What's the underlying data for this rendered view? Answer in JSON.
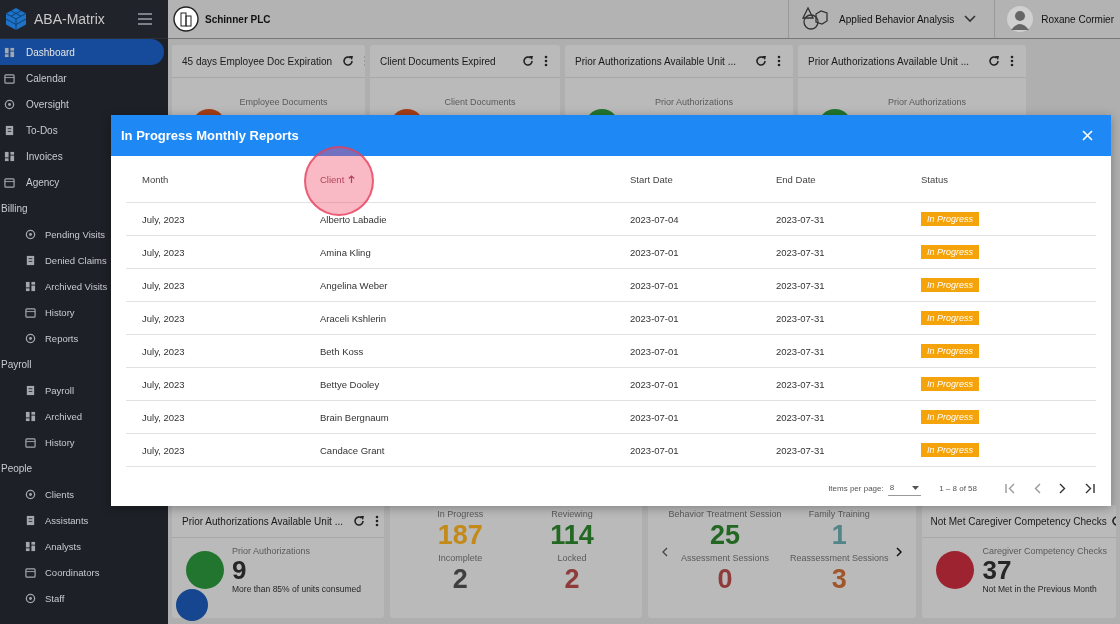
{
  "app": {
    "name": "ABA-Matrix"
  },
  "topbar": {
    "company": "Schinner PLC",
    "program": "Applied Behavior Analysis",
    "user": "Roxane Cormier"
  },
  "sidebar": {
    "items": [
      {
        "kind": "link",
        "label": "Dashboard",
        "selected": true
      },
      {
        "kind": "link",
        "label": "Calendar",
        "selected": false
      },
      {
        "kind": "link",
        "label": "Oversight",
        "selected": false
      },
      {
        "kind": "link",
        "label": "To-Dos",
        "selected": false
      },
      {
        "kind": "link",
        "label": "Invoices",
        "selected": false
      },
      {
        "kind": "link",
        "label": "Agency",
        "selected": false
      },
      {
        "kind": "section",
        "label": "Billing",
        "children": [
          {
            "kind": "link",
            "label": "Pending Visits",
            "selected": false
          },
          {
            "kind": "link",
            "label": "Denied Claims",
            "selected": false
          },
          {
            "kind": "link",
            "label": "Archived Visits",
            "selected": false
          },
          {
            "kind": "link",
            "label": "History",
            "selected": false
          },
          {
            "kind": "link",
            "label": "Reports",
            "selected": false
          }
        ]
      },
      {
        "kind": "section",
        "label": "Payroll",
        "children": [
          {
            "kind": "link",
            "label": "Payroll",
            "selected": false
          },
          {
            "kind": "link",
            "label": "Archived",
            "selected": false
          },
          {
            "kind": "link",
            "label": "History",
            "selected": false
          }
        ]
      },
      {
        "kind": "section",
        "label": "People",
        "children": [
          {
            "kind": "link",
            "label": "Clients",
            "selected": false
          },
          {
            "kind": "link",
            "label": "Assistants",
            "selected": false
          },
          {
            "kind": "link",
            "label": "Analysts",
            "selected": false
          },
          {
            "kind": "link",
            "label": "Coordinators",
            "selected": false
          },
          {
            "kind": "link",
            "label": "Staff",
            "selected": false
          }
        ]
      }
    ]
  },
  "top_cards": [
    {
      "title": "45 days Employee Doc Expiration",
      "subtitle": "Employee Documents",
      "color": "#a63d17"
    },
    {
      "title": "Client Documents Expired",
      "subtitle": "Client Documents",
      "color": "#a63d17"
    },
    {
      "title": "Prior Authorizations Available Unit ...",
      "subtitle": "Prior Authorizations",
      "color": "#22752e"
    },
    {
      "title": "Prior Authorizations Available Unit ...",
      "subtitle": "Prior Authorizations",
      "color": "#22752e"
    }
  ],
  "bottom_cards": [
    {
      "kind": "kpi",
      "title": "Prior Authorizations Available Unit ...",
      "label": "Prior Authorizations",
      "value": "9",
      "note": "More than 85% of units consumed",
      "color": "#22752e"
    },
    {
      "kind": "stats",
      "stats": [
        {
          "label": "In Progress",
          "value": "187",
          "color": "#c48a18"
        },
        {
          "label": "Reviewing",
          "value": "114",
          "color": "#226722"
        },
        {
          "label": "Incomplete",
          "value": "2",
          "color": "#3f3f3f"
        },
        {
          "label": "Locked",
          "value": "2",
          "color": "#8e3b39"
        }
      ]
    },
    {
      "kind": "carousel",
      "stats": [
        {
          "label": "Behavior Treatment Session",
          "value": "25",
          "color": "#226722"
        },
        {
          "label": "Family Training",
          "value": "1",
          "color": "#528588"
        },
        {
          "label": "Assessment Sessions",
          "value": "0",
          "color": "#8e3b39"
        },
        {
          "label": "Reassessment Sessions",
          "value": "3",
          "color": "#a1552b"
        }
      ]
    },
    {
      "kind": "kpi",
      "title": "Not Met Caregiver Competency Checks",
      "label": "Caregiver Competency Checks",
      "value": "37",
      "note": "Not Met in the Previous Month",
      "color": "#9c232f"
    }
  ],
  "dialog": {
    "title": "In Progress Monthly Reports",
    "columns": [
      {
        "label": "Month",
        "sorted": false
      },
      {
        "label": "Client",
        "sorted": true
      },
      {
        "label": "Start Date",
        "sorted": false
      },
      {
        "label": "End Date",
        "sorted": false
      },
      {
        "label": "Status",
        "sorted": false
      }
    ],
    "rows": [
      {
        "month": "July, 2023",
        "client": "Alberto Labadie",
        "start": "2023-07-04",
        "end": "2023-07-31",
        "status": "In Progress"
      },
      {
        "month": "July, 2023",
        "client": "Amina Kling",
        "start": "2023-07-01",
        "end": "2023-07-31",
        "status": "In Progress"
      },
      {
        "month": "July, 2023",
        "client": "Angelina Weber",
        "start": "2023-07-01",
        "end": "2023-07-31",
        "status": "In Progress"
      },
      {
        "month": "July, 2023",
        "client": "Araceli Kshlerin",
        "start": "2023-07-01",
        "end": "2023-07-31",
        "status": "In Progress"
      },
      {
        "month": "July, 2023",
        "client": "Beth Koss",
        "start": "2023-07-01",
        "end": "2023-07-31",
        "status": "In Progress"
      },
      {
        "month": "July, 2023",
        "client": "Bettye Dooley",
        "start": "2023-07-01",
        "end": "2023-07-31",
        "status": "In Progress"
      },
      {
        "month": "July, 2023",
        "client": "Brain Bergnaum",
        "start": "2023-07-01",
        "end": "2023-07-31",
        "status": "In Progress"
      },
      {
        "month": "July, 2023",
        "client": "Candace Grant",
        "start": "2023-07-01",
        "end": "2023-07-31",
        "status": "In Progress"
      }
    ],
    "items_per_page_label": "Items per page:",
    "items_per_page": "8",
    "range": "1 – 8 of 58"
  }
}
